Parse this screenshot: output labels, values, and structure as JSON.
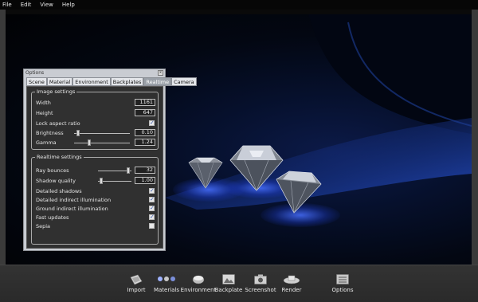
{
  "menubar": {
    "items": [
      "File",
      "Edit",
      "View",
      "Help"
    ]
  },
  "options": {
    "title": "Options",
    "close_glyph": "x",
    "tabs": [
      "Scene",
      "Material",
      "Environment",
      "Backplates",
      "Realtime",
      "Camera"
    ],
    "active_tab": "Realtime",
    "image_settings": {
      "title": "Image settings",
      "width_label": "Width",
      "width_value": "1161",
      "height_label": "Height",
      "height_value": "647",
      "lock_label": "Lock aspect ratio",
      "lock_checked": true,
      "brightness_label": "Brightness",
      "brightness_value": "0.10",
      "brightness_level": 0.05,
      "gamma_label": "Gamma",
      "gamma_value": "1.24",
      "gamma_level": 0.25
    },
    "realtime_settings": {
      "title": "Realtime settings",
      "ray_bounces_label": "Ray bounces",
      "ray_bounces_value": "32",
      "ray_bounces_level": 0.95,
      "shadow_quality_label": "Shadow quality",
      "shadow_quality_value": "1.00",
      "shadow_quality_level": 0.05,
      "checks": [
        {
          "label": "Detailed shadows",
          "checked": true
        },
        {
          "label": "Detailed indirect illumination",
          "checked": true
        },
        {
          "label": "Ground indirect illumination",
          "checked": true
        },
        {
          "label": "Fast updates",
          "checked": true
        },
        {
          "label": "Sepia",
          "checked": false
        }
      ]
    }
  },
  "toolbar": {
    "items": [
      {
        "label": "Import",
        "icon": "import-icon"
      },
      {
        "label": "Materials",
        "icon": "materials-icon"
      },
      {
        "label": "Environment",
        "icon": "environment-icon"
      },
      {
        "label": "Backplate",
        "icon": "backplate-icon"
      },
      {
        "label": "Screenshot",
        "icon": "screenshot-icon"
      },
      {
        "label": "Render",
        "icon": "render-icon"
      },
      {
        "label": "Options",
        "icon": "options-icon"
      }
    ]
  },
  "colors": {
    "viewport_glow": "#2a4cff",
    "panel_bg": "#303030",
    "frame": "#3a3a3a"
  }
}
